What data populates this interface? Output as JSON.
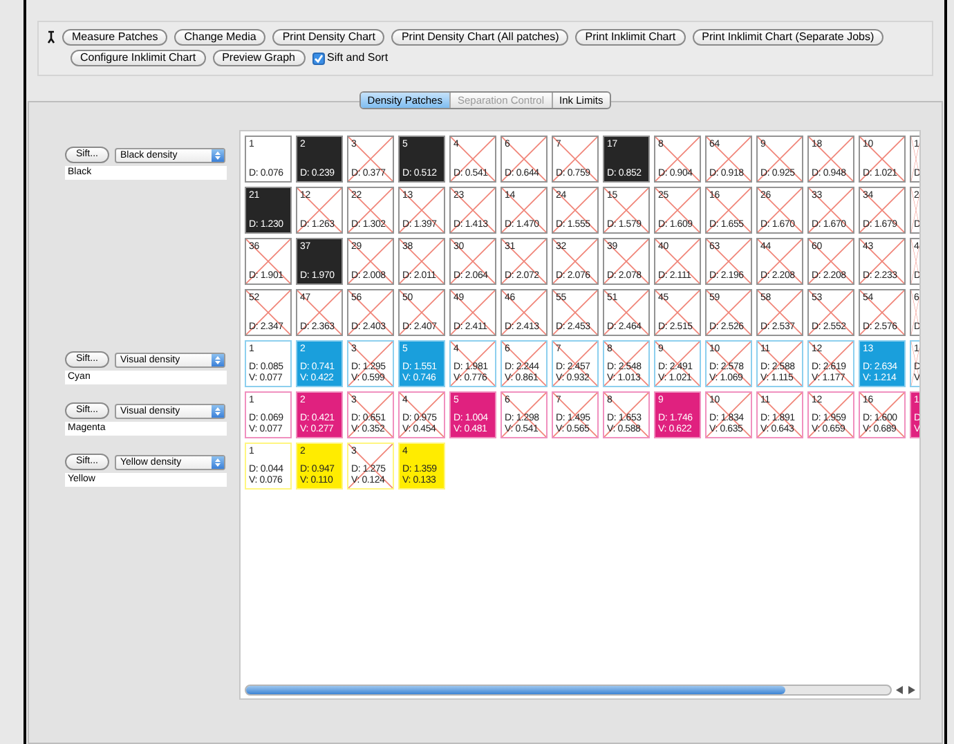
{
  "toolbar": {
    "buttons": [
      "Measure Patches",
      "Change Media",
      "Print Density Chart",
      "Print Density Chart (All patches)",
      "Print Inklimit Chart",
      "Print Inklimit Chart (Separate Jobs)",
      "Configure Inklimit Chart",
      "Preview Graph"
    ],
    "checkbox": {
      "label": "Sift and Sort",
      "checked": true
    }
  },
  "tabs": [
    {
      "label": "Density Patches",
      "selected": true,
      "disabled": false
    },
    {
      "label": "Separation Control",
      "selected": false,
      "disabled": true
    },
    {
      "label": "Ink Limits",
      "selected": false,
      "disabled": false
    }
  ],
  "channels": [
    {
      "name": "Black",
      "sift_button": "Sift...",
      "density_mode": "Black density",
      "color": "#262626",
      "rows": [
        {
          "patches": [
            {
              "number": "1",
              "density": "D: 0.076",
              "selected": false,
              "crossed": false
            },
            {
              "number": "2",
              "density": "D: 0.239",
              "selected": true,
              "crossed": false
            },
            {
              "number": "3",
              "density": "D: 0.377",
              "selected": false,
              "crossed": true
            },
            {
              "number": "5",
              "density": "D: 0.512",
              "selected": true,
              "crossed": false
            },
            {
              "number": "4",
              "density": "D: 0.541",
              "selected": false,
              "crossed": true
            },
            {
              "number": "6",
              "density": "D: 0.644",
              "selected": false,
              "crossed": true
            },
            {
              "number": "7",
              "density": "D: 0.759",
              "selected": false,
              "crossed": true
            },
            {
              "number": "17",
              "density": "D: 0.852",
              "selected": true,
              "crossed": false
            },
            {
              "number": "8",
              "density": "D: 0.904",
              "selected": false,
              "crossed": true
            },
            {
              "number": "64",
              "density": "D: 0.918",
              "selected": false,
              "crossed": true
            },
            {
              "number": "9",
              "density": "D: 0.925",
              "selected": false,
              "crossed": true
            },
            {
              "number": "18",
              "density": "D: 0.948",
              "selected": false,
              "crossed": true
            },
            {
              "number": "10",
              "density": "D: 1.021",
              "selected": false,
              "crossed": true
            }
          ],
          "cut_off": {
            "number": "1",
            "density": "D",
            "selected": false,
            "crossed": true
          }
        },
        {
          "patches": [
            {
              "number": "21",
              "density": "D: 1.230",
              "selected": true,
              "crossed": false
            },
            {
              "number": "12",
              "density": "D: 1.263",
              "selected": false,
              "crossed": true
            },
            {
              "number": "22",
              "density": "D: 1.302",
              "selected": false,
              "crossed": true
            },
            {
              "number": "13",
              "density": "D: 1.397",
              "selected": false,
              "crossed": true
            },
            {
              "number": "23",
              "density": "D: 1.413",
              "selected": false,
              "crossed": true
            },
            {
              "number": "14",
              "density": "D: 1.470",
              "selected": false,
              "crossed": true
            },
            {
              "number": "24",
              "density": "D: 1.555",
              "selected": false,
              "crossed": true
            },
            {
              "number": "15",
              "density": "D: 1.579",
              "selected": false,
              "crossed": true
            },
            {
              "number": "25",
              "density": "D: 1.609",
              "selected": false,
              "crossed": true
            },
            {
              "number": "16",
              "density": "D: 1.655",
              "selected": false,
              "crossed": true
            },
            {
              "number": "26",
              "density": "D: 1.670",
              "selected": false,
              "crossed": true
            },
            {
              "number": "33",
              "density": "D: 1.670",
              "selected": false,
              "crossed": true
            },
            {
              "number": "34",
              "density": "D: 1.679",
              "selected": false,
              "crossed": true
            }
          ],
          "cut_off": {
            "number": "2",
            "density": "D",
            "selected": false,
            "crossed": true
          }
        },
        {
          "patches": [
            {
              "number": "36",
              "density": "D: 1.901",
              "selected": false,
              "crossed": true
            },
            {
              "number": "37",
              "density": "D: 1.970",
              "selected": true,
              "crossed": false
            },
            {
              "number": "29",
              "density": "D: 2.008",
              "selected": false,
              "crossed": true
            },
            {
              "number": "38",
              "density": "D: 2.011",
              "selected": false,
              "crossed": true
            },
            {
              "number": "30",
              "density": "D: 2.064",
              "selected": false,
              "crossed": true
            },
            {
              "number": "31",
              "density": "D: 2.072",
              "selected": false,
              "crossed": true
            },
            {
              "number": "32",
              "density": "D: 2.076",
              "selected": false,
              "crossed": true
            },
            {
              "number": "39",
              "density": "D: 2.078",
              "selected": false,
              "crossed": true
            },
            {
              "number": "40",
              "density": "D: 2.111",
              "selected": false,
              "crossed": true
            },
            {
              "number": "63",
              "density": "D: 2.196",
              "selected": false,
              "crossed": true
            },
            {
              "number": "44",
              "density": "D: 2.208",
              "selected": false,
              "crossed": true
            },
            {
              "number": "60",
              "density": "D: 2.208",
              "selected": false,
              "crossed": true
            },
            {
              "number": "43",
              "density": "D: 2.233",
              "selected": false,
              "crossed": true
            }
          ],
          "cut_off": {
            "number": "4",
            "density": "D",
            "selected": false,
            "crossed": true
          }
        },
        {
          "patches": [
            {
              "number": "52",
              "density": "D: 2.347",
              "selected": false,
              "crossed": true
            },
            {
              "number": "47",
              "density": "D: 2.363",
              "selected": false,
              "crossed": true
            },
            {
              "number": "56",
              "density": "D: 2.403",
              "selected": false,
              "crossed": true
            },
            {
              "number": "50",
              "density": "D: 2.407",
              "selected": false,
              "crossed": true
            },
            {
              "number": "49",
              "density": "D: 2.411",
              "selected": false,
              "crossed": true
            },
            {
              "number": "46",
              "density": "D: 2.413",
              "selected": false,
              "crossed": true
            },
            {
              "number": "55",
              "density": "D: 2.453",
              "selected": false,
              "crossed": true
            },
            {
              "number": "51",
              "density": "D: 2.464",
              "selected": false,
              "crossed": true
            },
            {
              "number": "45",
              "density": "D: 2.515",
              "selected": false,
              "crossed": true
            },
            {
              "number": "59",
              "density": "D: 2.526",
              "selected": false,
              "crossed": true
            },
            {
              "number": "58",
              "density": "D: 2.537",
              "selected": false,
              "crossed": true
            },
            {
              "number": "53",
              "density": "D: 2.552",
              "selected": false,
              "crossed": true
            },
            {
              "number": "54",
              "density": "D: 2.576",
              "selected": false,
              "crossed": true
            }
          ],
          "cut_off": {
            "number": "6",
            "density": "D",
            "selected": false,
            "crossed": true
          }
        }
      ]
    },
    {
      "name": "Cyan",
      "sift_button": "Sift...",
      "density_mode": "Visual density",
      "color": "#1a9fdc",
      "rows": [
        {
          "patches": [
            {
              "number": "1",
              "density": "D: 0.085",
              "visual": "V: 0.077",
              "selected": false,
              "crossed": false
            },
            {
              "number": "2",
              "density": "D: 0.741",
              "visual": "V: 0.422",
              "selected": true,
              "crossed": false
            },
            {
              "number": "3",
              "density": "D: 1.295",
              "visual": "V: 0.599",
              "selected": false,
              "crossed": true
            },
            {
              "number": "5",
              "density": "D: 1.551",
              "visual": "V: 0.746",
              "selected": true,
              "crossed": false
            },
            {
              "number": "4",
              "density": "D: 1.981",
              "visual": "V: 0.776",
              "selected": false,
              "crossed": true
            },
            {
              "number": "6",
              "density": "D: 2.244",
              "visual": "V: 0.861",
              "selected": false,
              "crossed": true
            },
            {
              "number": "7",
              "density": "D: 2.457",
              "visual": "V: 0.932",
              "selected": false,
              "crossed": true
            },
            {
              "number": "8",
              "density": "D: 2.548",
              "visual": "V: 1.013",
              "selected": false,
              "crossed": true
            },
            {
              "number": "9",
              "density": "D: 2.491",
              "visual": "V: 1.021",
              "selected": false,
              "crossed": true
            },
            {
              "number": "10",
              "density": "D: 2.578",
              "visual": "V: 1.069",
              "selected": false,
              "crossed": true
            },
            {
              "number": "11",
              "density": "D: 2.588",
              "visual": "V: 1.115",
              "selected": false,
              "crossed": true
            },
            {
              "number": "12",
              "density": "D: 2.619",
              "visual": "V: 1.177",
              "selected": false,
              "crossed": true
            },
            {
              "number": "13",
              "density": "D: 2.634",
              "visual": "V: 1.214",
              "selected": true,
              "crossed": false
            }
          ],
          "cut_off": {
            "number": "1",
            "density": "D",
            "visual": "V",
            "selected": false,
            "crossed": true
          }
        }
      ]
    },
    {
      "name": "Magenta",
      "sift_button": "Sift...",
      "density_mode": "Visual density",
      "color": "#e0217f",
      "rows": [
        {
          "patches": [
            {
              "number": "1",
              "density": "D: 0.069",
              "visual": "V: 0.077",
              "selected": false,
              "crossed": false
            },
            {
              "number": "2",
              "density": "D: 0.421",
              "visual": "V: 0.277",
              "selected": true,
              "crossed": false
            },
            {
              "number": "3",
              "density": "D: 0.651",
              "visual": "V: 0.352",
              "selected": false,
              "crossed": true
            },
            {
              "number": "4",
              "density": "D: 0.975",
              "visual": "V: 0.454",
              "selected": false,
              "crossed": true
            },
            {
              "number": "5",
              "density": "D: 1.004",
              "visual": "V: 0.481",
              "selected": true,
              "crossed": false
            },
            {
              "number": "6",
              "density": "D: 1.298",
              "visual": "V: 0.541",
              "selected": false,
              "crossed": true
            },
            {
              "number": "7",
              "density": "D: 1.495",
              "visual": "V: 0.565",
              "selected": false,
              "crossed": true
            },
            {
              "number": "8",
              "density": "D: 1.653",
              "visual": "V: 0.588",
              "selected": false,
              "crossed": true
            },
            {
              "number": "9",
              "density": "D: 1.746",
              "visual": "V: 0.622",
              "selected": true,
              "crossed": false
            },
            {
              "number": "10",
              "density": "D: 1.834",
              "visual": "V: 0.635",
              "selected": false,
              "crossed": true
            },
            {
              "number": "11",
              "density": "D: 1.891",
              "visual": "V: 0.643",
              "selected": false,
              "crossed": true
            },
            {
              "number": "12",
              "density": "D: 1.959",
              "visual": "V: 0.659",
              "selected": false,
              "crossed": true
            },
            {
              "number": "16",
              "density": "D: 1.600",
              "visual": "V: 0.689",
              "selected": false,
              "crossed": true
            }
          ],
          "cut_off": {
            "number": "1",
            "density": "D",
            "visual": "V",
            "selected": true,
            "crossed": false
          }
        }
      ]
    },
    {
      "name": "Yellow",
      "sift_button": "Sift...",
      "density_mode": "Yellow density",
      "color": "#ffec00",
      "rows": [
        {
          "patches": [
            {
              "number": "1",
              "density": "D: 0.044",
              "visual": "V: 0.076",
              "selected": false,
              "crossed": false
            },
            {
              "number": "2",
              "density": "D: 0.947",
              "visual": "V: 0.110",
              "selected": true,
              "crossed": false
            },
            {
              "number": "3",
              "density": "D: 1.275",
              "visual": "V: 0.124",
              "selected": false,
              "crossed": true
            },
            {
              "number": "4",
              "density": "D: 1.359",
              "visual": "V: 0.133",
              "selected": true,
              "crossed": false
            }
          ]
        }
      ]
    }
  ]
}
